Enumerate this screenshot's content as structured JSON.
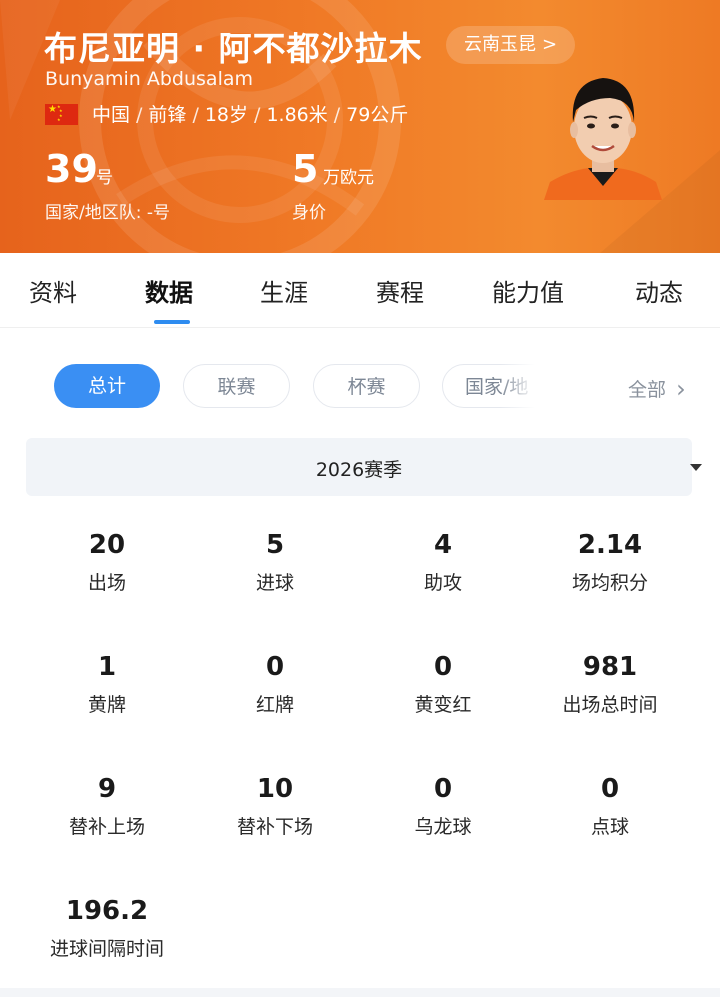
{
  "player": {
    "name_cn": "布尼亚明 · 阿不都沙拉木",
    "name_en": "Bunyamin Abdusalam",
    "club": "云南玉昆",
    "club_chevron": ">",
    "info": [
      "中国",
      "前锋",
      "18岁",
      "1.86米",
      "79公斤"
    ],
    "info_sep": "/",
    "shirt_number": "39",
    "shirt_unit": "号",
    "national_team": "国家/地区队: -号",
    "value": "5",
    "value_unit": "万欧元",
    "value_label": "身价"
  },
  "tabs": [
    "资料",
    "数据",
    "生涯",
    "赛程",
    "能力值",
    "动态"
  ],
  "active_tab": "数据",
  "filters": {
    "chips": [
      "总计",
      "联赛",
      "杯赛",
      "国家/地"
    ],
    "selected": "总计",
    "all_label": "全部",
    "all_chevron": "›"
  },
  "season": {
    "label": "2026赛季"
  },
  "stats": [
    {
      "value": "20",
      "label": "出场"
    },
    {
      "value": "5",
      "label": "进球"
    },
    {
      "value": "4",
      "label": "助攻"
    },
    {
      "value": "2.14",
      "label": "场均积分"
    },
    {
      "value": "1",
      "label": "黄牌"
    },
    {
      "value": "0",
      "label": "红牌"
    },
    {
      "value": "0",
      "label": "黄变红"
    },
    {
      "value": "981",
      "label": "出场总时间"
    },
    {
      "value": "9",
      "label": "替补上场"
    },
    {
      "value": "10",
      "label": "替补下场"
    },
    {
      "value": "0",
      "label": "乌龙球"
    },
    {
      "value": "0",
      "label": "点球"
    },
    {
      "value": "196.2",
      "label": "进球间隔时间"
    }
  ],
  "colors": {
    "header_orange": "#f07a26",
    "accent_blue": "#3a8ff3",
    "flag_red": "#de2910",
    "flag_yellow": "#ffde00"
  }
}
